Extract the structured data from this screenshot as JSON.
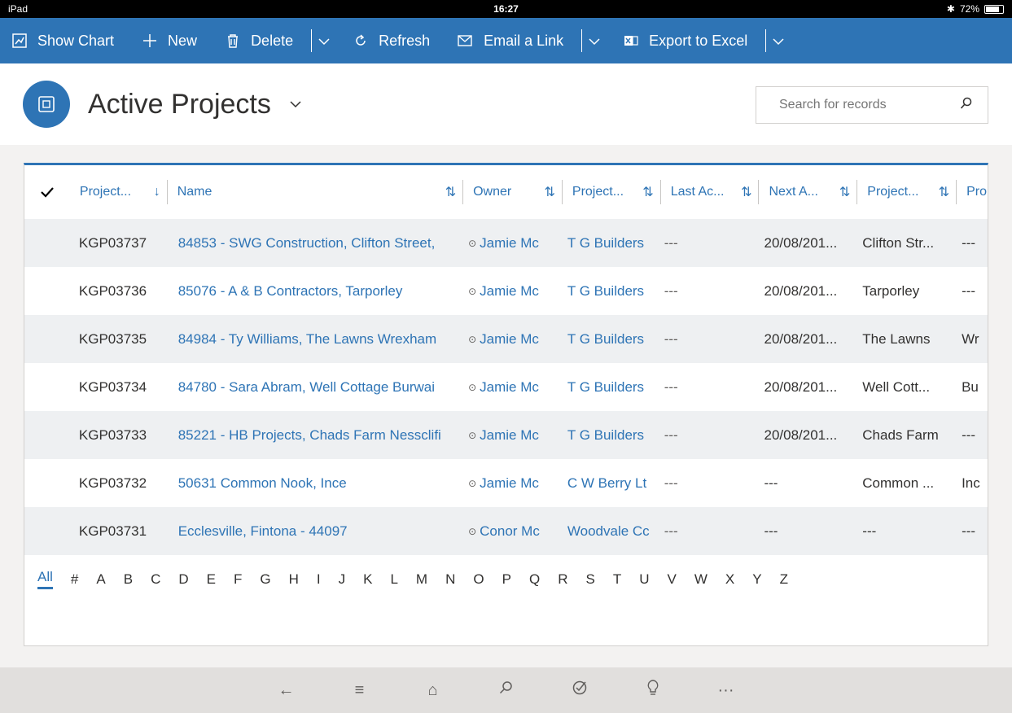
{
  "status": {
    "device": "iPad",
    "time": "16:27",
    "bluetooth": "✱",
    "battery": "72%"
  },
  "toolbar": {
    "show_chart": "Show Chart",
    "new": "New",
    "delete": "Delete",
    "refresh": "Refresh",
    "email_link": "Email a Link",
    "export_excel": "Export to Excel"
  },
  "header": {
    "title": "Active Projects",
    "search_placeholder": "Search for records"
  },
  "grid": {
    "columns": [
      "Project...",
      "Name",
      "Owner",
      "Project...",
      "Last Ac...",
      "Next A...",
      "Project...",
      "Pro"
    ],
    "rows": [
      {
        "id": "KGP03737",
        "name": "84853 - SWG Construction, Clifton Street,",
        "owner": "Jamie Mc",
        "company": "T G Builders",
        "last": "---",
        "next": "20/08/201...",
        "proj": "Clifton Str...",
        "extra": "---"
      },
      {
        "id": "KGP03736",
        "name": "85076 - A & B Contractors, Tarporley",
        "owner": "Jamie Mc",
        "company": "T G Builders",
        "last": "---",
        "next": "20/08/201...",
        "proj": "Tarporley",
        "extra": "---"
      },
      {
        "id": "KGP03735",
        "name": "84984 - Ty Williams, The Lawns Wrexham",
        "owner": "Jamie Mc",
        "company": "T G Builders",
        "last": "---",
        "next": "20/08/201...",
        "proj": "The Lawns",
        "extra": "Wr"
      },
      {
        "id": "KGP03734",
        "name": "84780 - Sara Abram, Well Cottage Burwai",
        "owner": "Jamie Mc",
        "company": "T G Builders",
        "last": "---",
        "next": "20/08/201...",
        "proj": "Well Cott...",
        "extra": "Bu"
      },
      {
        "id": "KGP03733",
        "name": "85221 - HB Projects, Chads Farm Nessclifi",
        "owner": "Jamie Mc",
        "company": "T G Builders",
        "last": "---",
        "next": "20/08/201...",
        "proj": "Chads Farm",
        "extra": "---"
      },
      {
        "id": "KGP03732",
        "name": "50631 Common Nook, Ince",
        "owner": "Jamie Mc",
        "company": "C W Berry Lt",
        "last": "---",
        "next": "---",
        "proj": "Common ...",
        "extra": "Inc"
      },
      {
        "id": "KGP03731",
        "name": "Ecclesville, Fintona - 44097",
        "owner": "Conor Mc",
        "company": "Woodvale Cc",
        "last": "---",
        "next": "---",
        "proj": "---",
        "extra": "---"
      }
    ]
  },
  "alphabet": [
    "All",
    "#",
    "A",
    "B",
    "C",
    "D",
    "E",
    "F",
    "G",
    "H",
    "I",
    "J",
    "K",
    "L",
    "M",
    "N",
    "O",
    "P",
    "Q",
    "R",
    "S",
    "T",
    "U",
    "V",
    "W",
    "X",
    "Y",
    "Z"
  ],
  "icons": {
    "back": "←",
    "menu": "≡",
    "home": "⌂",
    "search": "⚲",
    "activity": "⊘",
    "idea": "♀",
    "more": "···"
  }
}
